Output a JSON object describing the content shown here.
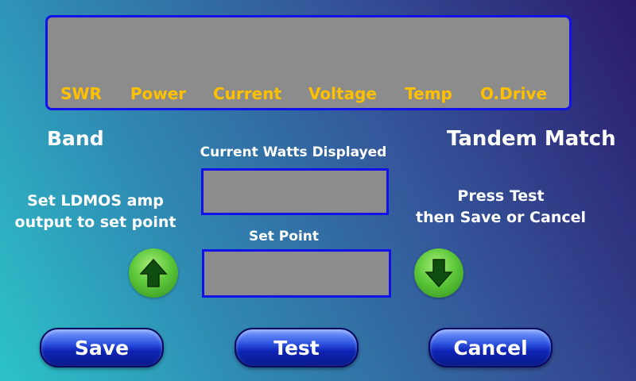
{
  "meter_panel": {
    "labels": [
      "SWR",
      "Power",
      "Current",
      "Voltage",
      "Temp",
      "O.Drive"
    ],
    "label_color": "#ffc000",
    "background": "#8c8c8c",
    "border_color": "#1212e8"
  },
  "band_label": "Band",
  "title": "Tandem Match",
  "instruction_left": [
    "Set LDMOS amp",
    "output to set point"
  ],
  "instruction_right": [
    "Press Test",
    "then Save or Cancel"
  ],
  "current_watts": {
    "label": "Current Watts Displayed",
    "value": ""
  },
  "set_point": {
    "label": "Set Point",
    "value": ""
  },
  "buttons": {
    "increase_icon": "arrow-up-icon",
    "decrease_icon": "arrow-down-icon",
    "save": "Save",
    "test": "Test",
    "cancel": "Cancel"
  }
}
